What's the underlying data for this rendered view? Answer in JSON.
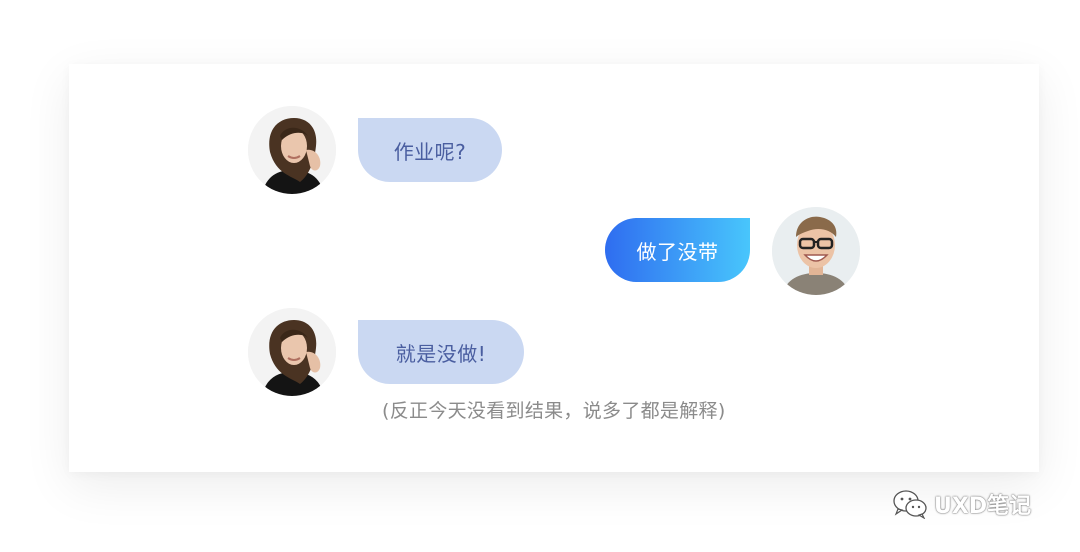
{
  "messages": [
    {
      "sender": "female",
      "side": "left",
      "text": "作业呢?"
    },
    {
      "sender": "male",
      "side": "right",
      "text": "做了没带"
    },
    {
      "sender": "female",
      "side": "left",
      "text": "就是没做!"
    }
  ],
  "note": "(反正今天没看到结果，说多了都是解释)",
  "watermark": {
    "icon": "wechat-icon",
    "text": "UXD笔记"
  },
  "colors": {
    "left_bubble": "#cad8f2",
    "left_text": "#4a5ea0",
    "right_gradient_start": "#2f6df0",
    "right_gradient_end": "#48c6fc",
    "right_text": "#ffffff",
    "note_text": "#8b8b8b"
  }
}
